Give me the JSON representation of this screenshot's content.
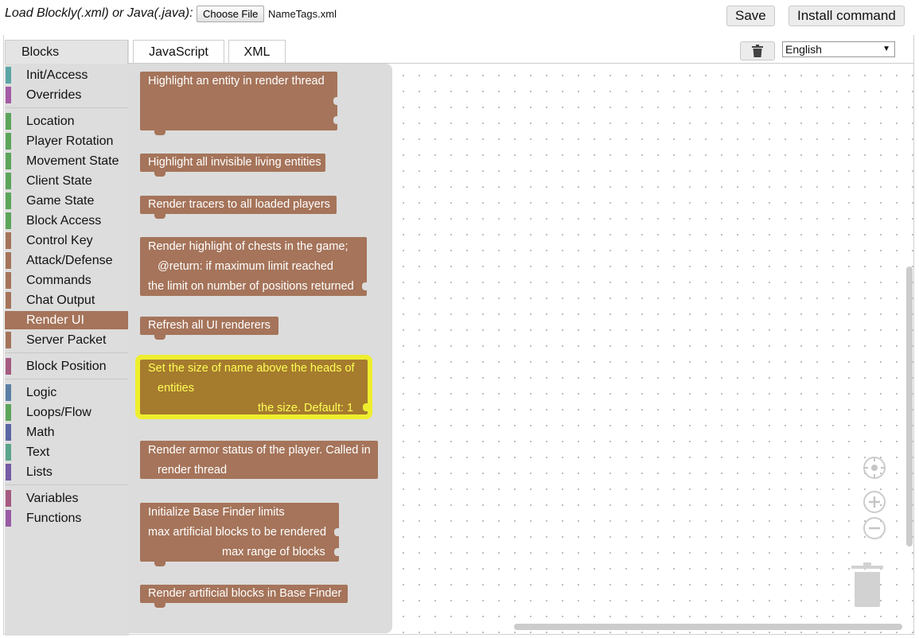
{
  "header": {
    "load_label": "Load Blockly(.xml) or Java(.java):",
    "choose_file": "Choose File",
    "file_name": "NameTags.xml",
    "save": "Save",
    "install": "Install command"
  },
  "tabs": {
    "blocks": "Blocks",
    "javascript": "JavaScript",
    "xml": "XML"
  },
  "language": {
    "selected": "English"
  },
  "toolbox": [
    {
      "label": "Init/Access",
      "color": "#5ba5a5"
    },
    {
      "label": "Overrides",
      "color": "#a55ba5"
    },
    {
      "label": "Location",
      "color": "#5ba55b"
    },
    {
      "label": "Player Rotation",
      "color": "#5ba55b"
    },
    {
      "label": "Movement State",
      "color": "#5ba55b"
    },
    {
      "label": "Client State",
      "color": "#5ba55b"
    },
    {
      "label": "Game State",
      "color": "#5ba55b"
    },
    {
      "label": "Block Access",
      "color": "#5ba55b"
    },
    {
      "label": "Control Key",
      "color": "#a5745a"
    },
    {
      "label": "Attack/Defense",
      "color": "#a5745a"
    },
    {
      "label": "Commands",
      "color": "#a5745a"
    },
    {
      "label": "Chat Output",
      "color": "#a5745a"
    },
    {
      "label": "Render UI",
      "color": "#a5745a"
    },
    {
      "label": "Server Packet",
      "color": "#a5745a"
    },
    {
      "label": "Block Position",
      "color": "#a55b80"
    },
    {
      "label": "Logic",
      "color": "#5b80a5"
    },
    {
      "label": "Loops/Flow",
      "color": "#5ba55b"
    },
    {
      "label": "Math",
      "color": "#5b67a5"
    },
    {
      "label": "Text",
      "color": "#5ba58c"
    },
    {
      "label": "Lists",
      "color": "#745ba5"
    },
    {
      "label": "Variables",
      "color": "#a55b80"
    },
    {
      "label": "Functions",
      "color": "#995ba5"
    }
  ],
  "blocks": {
    "b1": [
      "Highlight an entity in render thread"
    ],
    "b2": [
      "Highlight all invisible living entities"
    ],
    "b3": [
      "Render tracers to all loaded players"
    ],
    "b4": [
      "Render highlight of chests in the game;",
      "@return: if maximum limit reached",
      "the limit on number of positions returned"
    ],
    "b5": [
      "Refresh all UI renderers"
    ],
    "b6": [
      "Set the size of name above the heads of",
      "entities",
      "the size. Default: 1"
    ],
    "b7": [
      "Render armor status of the player. Called in",
      "render thread"
    ],
    "b8": [
      "Initialize Base Finder limits",
      "max artificial blocks to be rendered",
      "max range of blocks"
    ],
    "b9": [
      "Render artificial blocks in Base Finder"
    ]
  }
}
